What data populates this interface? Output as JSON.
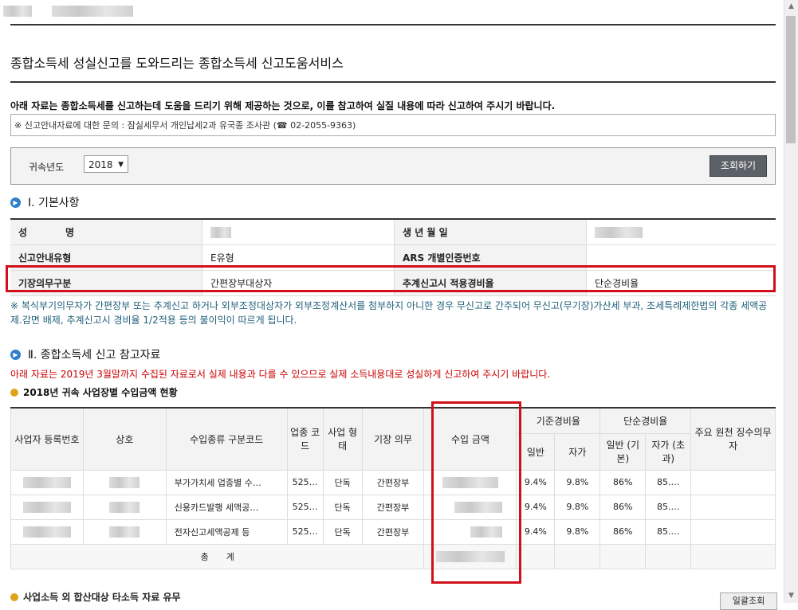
{
  "page": {
    "title": "종합소득세 성실신고를 도와드리는 종합소득세 신고도움서비스",
    "notice_bold": "아래 자료는 종합소득세를 신고하는데 도움을 드리기 위해 제공하는 것으로, 이를 참고하여 실질 내용에 따라 신고하여 주시기 바랍니다.",
    "notice_inquiry": "※ 신고안내자료에 대한 문의 : 잠실세무서 개인납세2과 유국종 조사관 (☎ 02-2055-9363)"
  },
  "year_filter": {
    "label": "귀속년도",
    "selected": "2018",
    "search_button": "조회하기"
  },
  "section1": {
    "heading": "Ⅰ. 기본사항",
    "rows": [
      {
        "k1": "성　　　　명",
        "v1": "",
        "k2": "생 년 월 일",
        "v2": ""
      },
      {
        "k1": "신고안내유형",
        "v1": "E유형",
        "k2": "ARS 개별인증번호",
        "v2": ""
      },
      {
        "k1": "기장의무구분",
        "v1": "간편장부대상자",
        "k2": "추계신고시 적용경비율",
        "v2": "단순경비율"
      }
    ],
    "warning": "※ 복식부기의무자가 간편장부 또는 추계신고 하거나 외부조정대상자가 외부조정계산서를 첨부하지 아니한 경우 무신고로 간주되어 무신고(무기장)가산세 부과, 조세특례제한법의 각종 세액공제.감면 배제, 추계신고시 경비율 1/2적용 등의 불이익이 따르게 됩니다."
  },
  "section2": {
    "heading": "Ⅱ. 종합소득세 신고 참고자료",
    "red_note": "아래 자료는 2019년 3월말까지 수집된 자료로서 실제 내용과 다를 수 있으므로 실제 소득내용대로 성실하게 신고하여 주시기 바랍니다.",
    "subheading": "2018년 귀속 사업장별 수입금액 현황",
    "headers": {
      "biz_no": "사업자 등록번호",
      "name": "상호",
      "income_type": "수입종류 구분코드",
      "industry": "업종 코드",
      "biz_type": "사업 형태",
      "bookkeeping": "기장 의무",
      "amount": "수입 금액",
      "std_rate": "기준경비율",
      "simple_rate": "단순경비율",
      "general": "일반",
      "self": "자가",
      "general_basic": "일반 (기본)",
      "self_excess": "자가 (초과)",
      "withholding": "주요 원천 징수의무자"
    },
    "rows": [
      {
        "income_type": "부가가치세 업종별 수…",
        "industry": "525…",
        "biz_type": "단독",
        "bookkeeping": "간편장부",
        "std_general": "9.4%",
        "std_self": "9.8%",
        "simple_general": "86%",
        "simple_self": "85.…"
      },
      {
        "income_type": "신용카드발행 세액공…",
        "industry": "525…",
        "biz_type": "단독",
        "bookkeeping": "간편장부",
        "std_general": "9.4%",
        "std_self": "9.8%",
        "simple_general": "86%",
        "simple_self": "85.…"
      },
      {
        "income_type": "전자신고세액공제 등",
        "industry": "525…",
        "biz_type": "단독",
        "bookkeeping": "간편장부",
        "std_general": "9.4%",
        "std_self": "9.8%",
        "simple_general": "86%",
        "simple_self": "85.…"
      }
    ],
    "total_label": "총　　계"
  },
  "section3": {
    "subheading": "사업소득 외 합산대상 타소득 자료 유무",
    "button": "일괄조회"
  }
}
